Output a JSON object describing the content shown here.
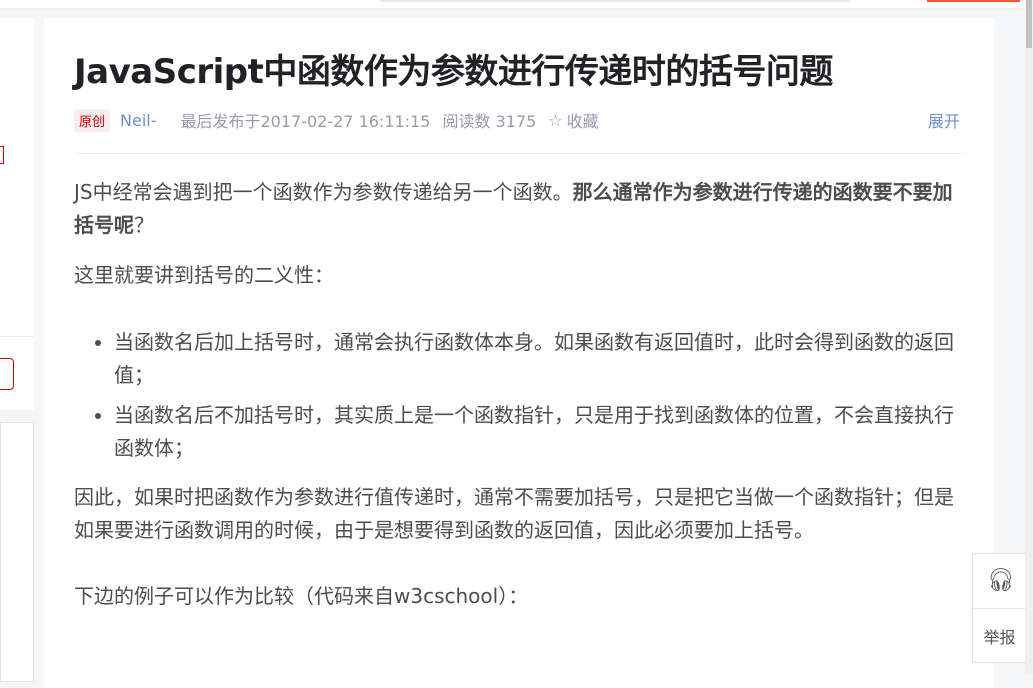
{
  "article": {
    "title": "JavaScript中函数作为参数进行传递时的括号问题",
    "badge": "原创",
    "author": "Neil-",
    "published": "最后发布于2017-02-27 16:11:15",
    "reads": "阅读数 3175",
    "favorite": "收藏",
    "expand": "展开",
    "p1_normal": "JS中经常会遇到把一个函数作为参数传递给另一个函数。",
    "p1_bold": "那么通常作为参数进行传递的函数要不要加括号呢",
    "p1_end": "？",
    "p2": "这里就要讲到括号的二义性：",
    "bullets": [
      "当函数名后加上括号时，通常会执行函数体本身。如果函数有返回值时，此时会得到函数的返回值；",
      "当函数名后不加括号时，其实质上是一个函数指针，只是用于找到函数体的位置，不会直接执行函数体；"
    ],
    "p3": "因此，如果时把函数作为参数进行值传递时，通常不需要加括号，只是把它当做一个函数指针；但是如果要进行函数调用的时候，由于是想要得到函数的返回值，因此必须要加上括号。",
    "p4": "下边的例子可以作为比较（代码来自w3cschool）："
  },
  "float": {
    "support_icon": "headset-icon",
    "report": "举报"
  }
}
